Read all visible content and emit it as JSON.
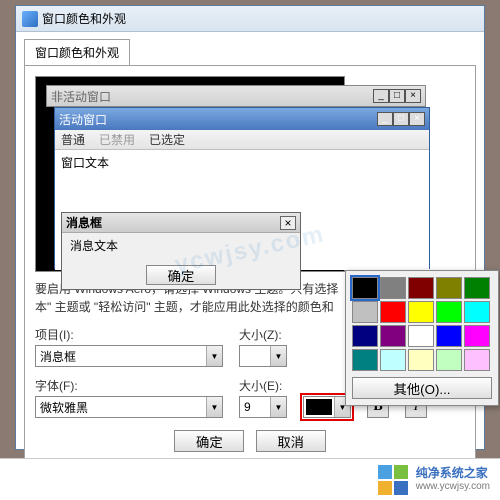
{
  "window": {
    "title": "窗口颜色和外观"
  },
  "tabs": {
    "label": "窗口颜色和外观"
  },
  "preview": {
    "inactive_title": "非活动窗口",
    "active_title": "活动窗口",
    "menu_normal": "普通",
    "menu_disabled": "已禁用",
    "menu_selected": "已选定",
    "window_text": "窗口文本",
    "msgbox_title": "消息框",
    "msgbox_text": "消息文本",
    "ok": "确定"
  },
  "desc_line1": "要启用 Windows Aero，请选择 Windows 主题。只有选择",
  "desc_line2": "本\" 主题或 \"轻松访问\" 主题，才能应用此处选择的颜色和",
  "form": {
    "item_label": "项目(I):",
    "item_value": "消息框",
    "size_label": "大小(Z):",
    "size_value": "",
    "font_label": "字体(F):",
    "font_value": "微软雅黑",
    "fontsize_label": "大小(E):",
    "fontsize_value": "9",
    "bold": "B",
    "italic": "I"
  },
  "palette": {
    "other": "其他(O)...",
    "colors": [
      "#000000",
      "#808080",
      "#800000",
      "#808000",
      "#008000",
      "#c0c0c0",
      "#ff0000",
      "#ffff00",
      "#00ff00",
      "#00ffff",
      "#000080",
      "#800080",
      "#ffffff",
      "#0000ff",
      "#ff00ff",
      "#008080",
      "#c0ffff",
      "#ffffc0",
      "#c0ffc0",
      "#ffc0ff"
    ]
  },
  "buttons": {
    "ok": "确定",
    "cancel": "取消"
  },
  "brand": {
    "name": "纯净系统之家",
    "url": "www.ycwjsy.com",
    "watermark": "ycwjsy.com"
  }
}
